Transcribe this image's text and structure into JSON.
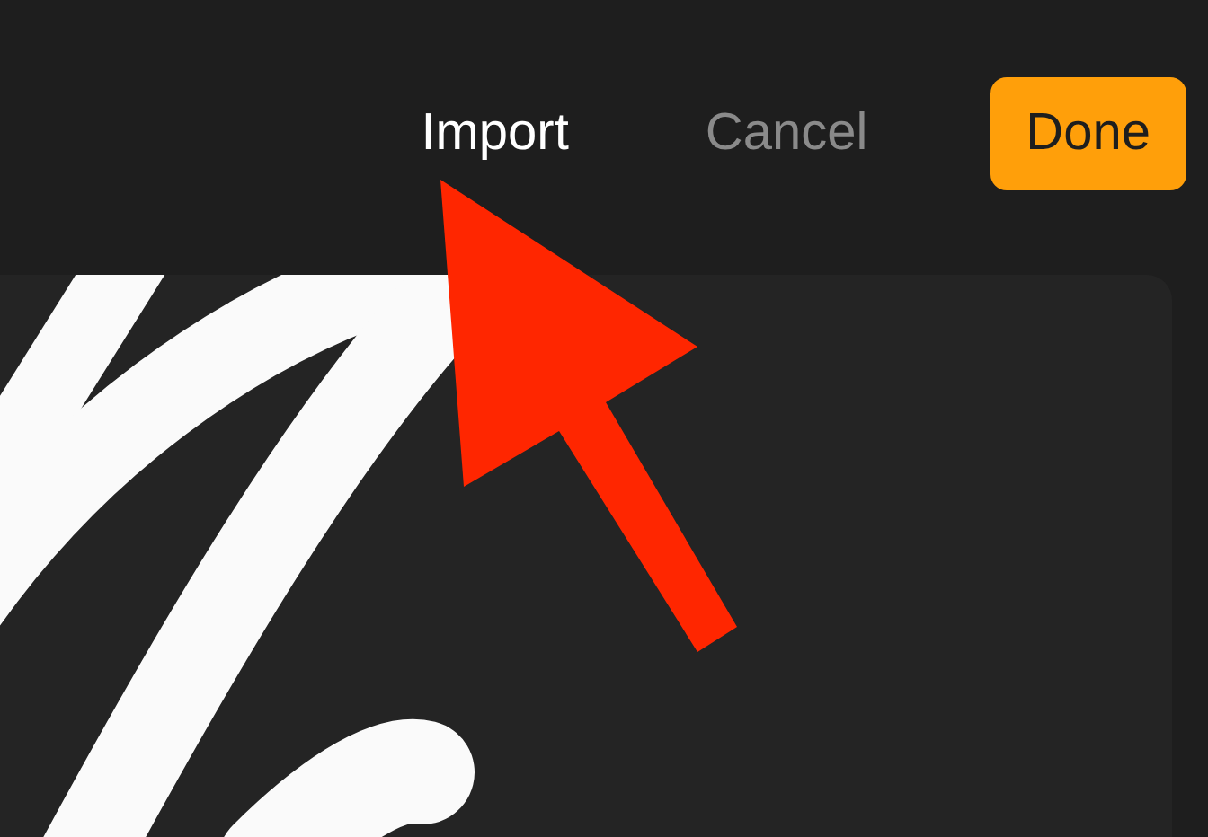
{
  "toolbar": {
    "buttons": [
      {
        "label": "Import",
        "kind": "text",
        "disabled": false
      },
      {
        "label": "Cancel",
        "kind": "text",
        "disabled": true
      },
      {
        "label": "Done",
        "kind": "primary",
        "disabled": false
      }
    ]
  }
}
